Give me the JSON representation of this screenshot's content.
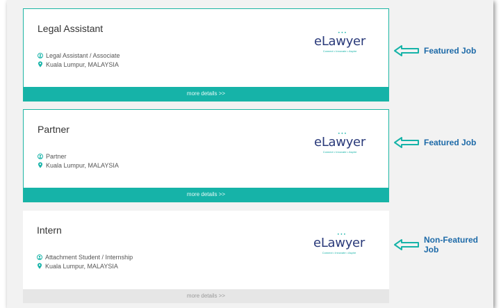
{
  "jobs": [
    {
      "title": "Legal Assistant",
      "position": "Legal Assistant / Associate",
      "location": "Kuala Lumpur, MALAYSIA",
      "more": "more details >>",
      "featured": true,
      "annotation": "Featured Job"
    },
    {
      "title": "Partner",
      "position": "Partner",
      "location": "Kuala Lumpur, MALAYSIA",
      "more": "more details >>",
      "featured": true,
      "annotation": "Featured Job"
    },
    {
      "title": "Intern",
      "position": "Attachment Student / Internship",
      "location": "Kuala Lumpur, MALAYSIA",
      "more": "more details >>",
      "featured": false,
      "annotation_line1": "Non-Featured",
      "annotation_line2": "Job"
    }
  ],
  "logo": {
    "word": "eLawyer",
    "tagline": "Connect • Innovate • Aspire"
  },
  "icons": {
    "person": "person-icon",
    "location": "location-pin-icon",
    "annotation": "left-arrow-icon"
  },
  "colors": {
    "accent": "#16b3a8",
    "annotation": "#1d6aa8",
    "logo_text": "#2a3a7a"
  }
}
